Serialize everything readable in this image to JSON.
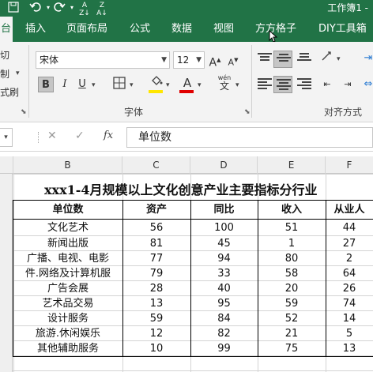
{
  "titlebar": {
    "workbook_title": "工作簿1 -",
    "icons": [
      "save-icon",
      "undo-icon",
      "redo-icon",
      "sort-asc-icon",
      "sort-desc-icon"
    ]
  },
  "tabs": [
    {
      "label": "台",
      "active": true
    },
    {
      "label": "插入"
    },
    {
      "label": "页面布局"
    },
    {
      "label": "公式"
    },
    {
      "label": "数据"
    },
    {
      "label": "视图"
    },
    {
      "label": "方方格子"
    },
    {
      "label": "DIY工具箱"
    }
  ],
  "ribbon": {
    "clipboard_fragments": [
      "切",
      "制",
      "式刷"
    ],
    "font_name": "宋体",
    "font_size": "12",
    "grow_font": "A",
    "shrink_font": "A",
    "bold": "B",
    "italic": "I",
    "underline": "U",
    "font_color_letter": "A",
    "phonetic_label": "wén",
    "phonetic_glyph": "文",
    "font_group_label": "字体",
    "alignment_group_label": "对齐方式",
    "accent_fill_color": "#ffe600",
    "accent_font_color": "#e00000"
  },
  "formula_bar": {
    "cancel_icon": "✕",
    "enter_icon": "✓",
    "fx_label": "fx",
    "content": "单位数"
  },
  "sheet": {
    "columns": [
      "B",
      "C",
      "D",
      "E",
      "F"
    ],
    "title": "xxx1-4月规模以上文化创意产业主要指标分行业",
    "headers": [
      "单位数",
      "资产",
      "同比",
      "收入",
      "从业人"
    ],
    "rows": [
      [
        "文化艺术",
        "56",
        "100",
        "51",
        "44"
      ],
      [
        "新闻出版",
        "81",
        "45",
        "1",
        "27"
      ],
      [
        "广播、电视、电影",
        "77",
        "94",
        "80",
        "2"
      ],
      [
        "件.网络及计算机服",
        "79",
        "33",
        "58",
        "64"
      ],
      [
        "广告会展",
        "28",
        "40",
        "20",
        "26"
      ],
      [
        "艺术品交易",
        "13",
        "95",
        "59",
        "74"
      ],
      [
        "设计服务",
        "59",
        "84",
        "52",
        "14"
      ],
      [
        "旅游.休闲娱乐",
        "12",
        "82",
        "21",
        "5"
      ],
      [
        "其他辅助服务",
        "10",
        "99",
        "75",
        "13"
      ]
    ]
  }
}
